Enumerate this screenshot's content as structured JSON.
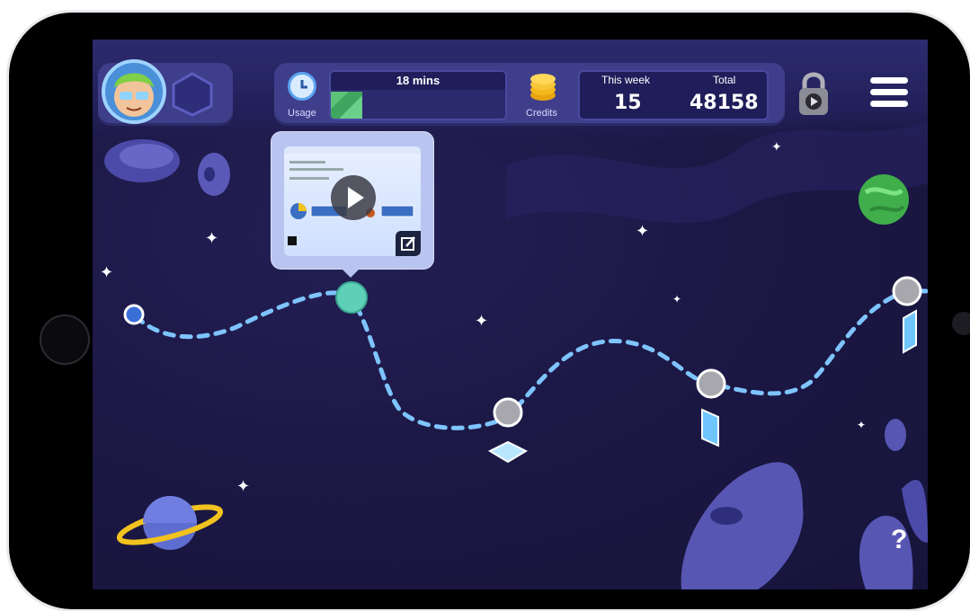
{
  "topbar": {
    "usage": {
      "label": "Usage",
      "time": "18 mins",
      "progress": 0.18
    },
    "credits": {
      "label": "Credits"
    },
    "stats": {
      "this_week_label": "This week",
      "total_label": "Total",
      "this_week_value": "15",
      "total_value": "48158"
    }
  },
  "colors": {
    "space_bg": "#1c1845",
    "path_dash": "#7ec4ff",
    "node_locked": "#a7a7ad",
    "node_current": "#5fd0b8",
    "node_start": "#3a6fd8",
    "accent_panel": "#3f3e8a"
  },
  "path_nodes": [
    {
      "state": "start"
    },
    {
      "state": "current"
    },
    {
      "state": "locked"
    },
    {
      "state": "locked"
    },
    {
      "state": "locked"
    }
  ],
  "icons": [
    "avatar",
    "hexagon-badge",
    "clock-icon",
    "coins-icon",
    "lock-icon",
    "menu-icon",
    "play-icon",
    "edit-icon",
    "help-icon"
  ],
  "help": {
    "label": "?"
  }
}
